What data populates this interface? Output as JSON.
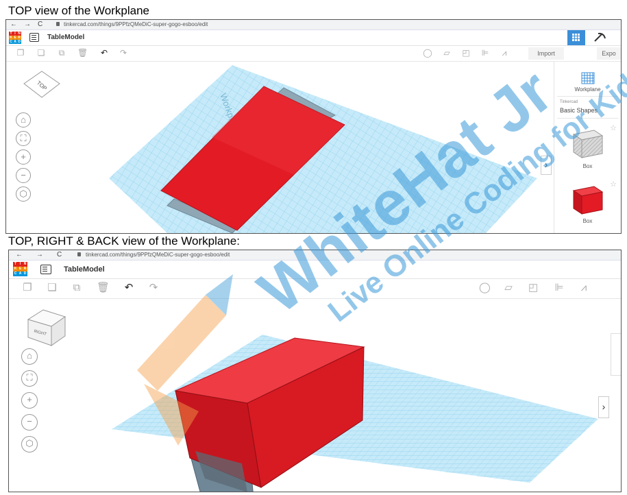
{
  "captions": {
    "top": "TOP view of the Workplane",
    "bottom": "TOP, RIGHT & BACK view of the Workplane:"
  },
  "browser": {
    "back": "←",
    "forward": "→",
    "reload": "C",
    "url": "tinkercad.com/things/9PPfzQMeDiC-super-gogo-esboo/edit"
  },
  "app": {
    "logo_letters": [
      "T",
      "I",
      "N",
      "K",
      "E",
      "R",
      "C",
      "A",
      "D"
    ],
    "logo_colors": [
      "#e2231a",
      "#e2231a",
      "#e2231a",
      "#f38b00",
      "#f38b00",
      "#f38b00",
      "#0096db",
      "#0096db",
      "#0096db"
    ],
    "model_title": "TableModel",
    "import_label": "Import",
    "export_label": "Expo"
  },
  "panel": {
    "workplane_label": "Workplane",
    "library_small": "Tinkercad",
    "library_name": "Basic Shapes",
    "shape1_label": "Box",
    "shape2_label": "Box",
    "collapse_glyph": "›"
  },
  "viewcube": {
    "top_face": "TOP",
    "right_face": "RIGHT"
  },
  "workplane_text": "Workplane",
  "watermark": {
    "brand": "WhiteHat Jr",
    "tagline": "Live Online Coding for Kids"
  },
  "colors": {
    "box_red": "#e31b25",
    "grid_blue": "#bfe6f7",
    "accent_blue": "#3b8fd9"
  }
}
